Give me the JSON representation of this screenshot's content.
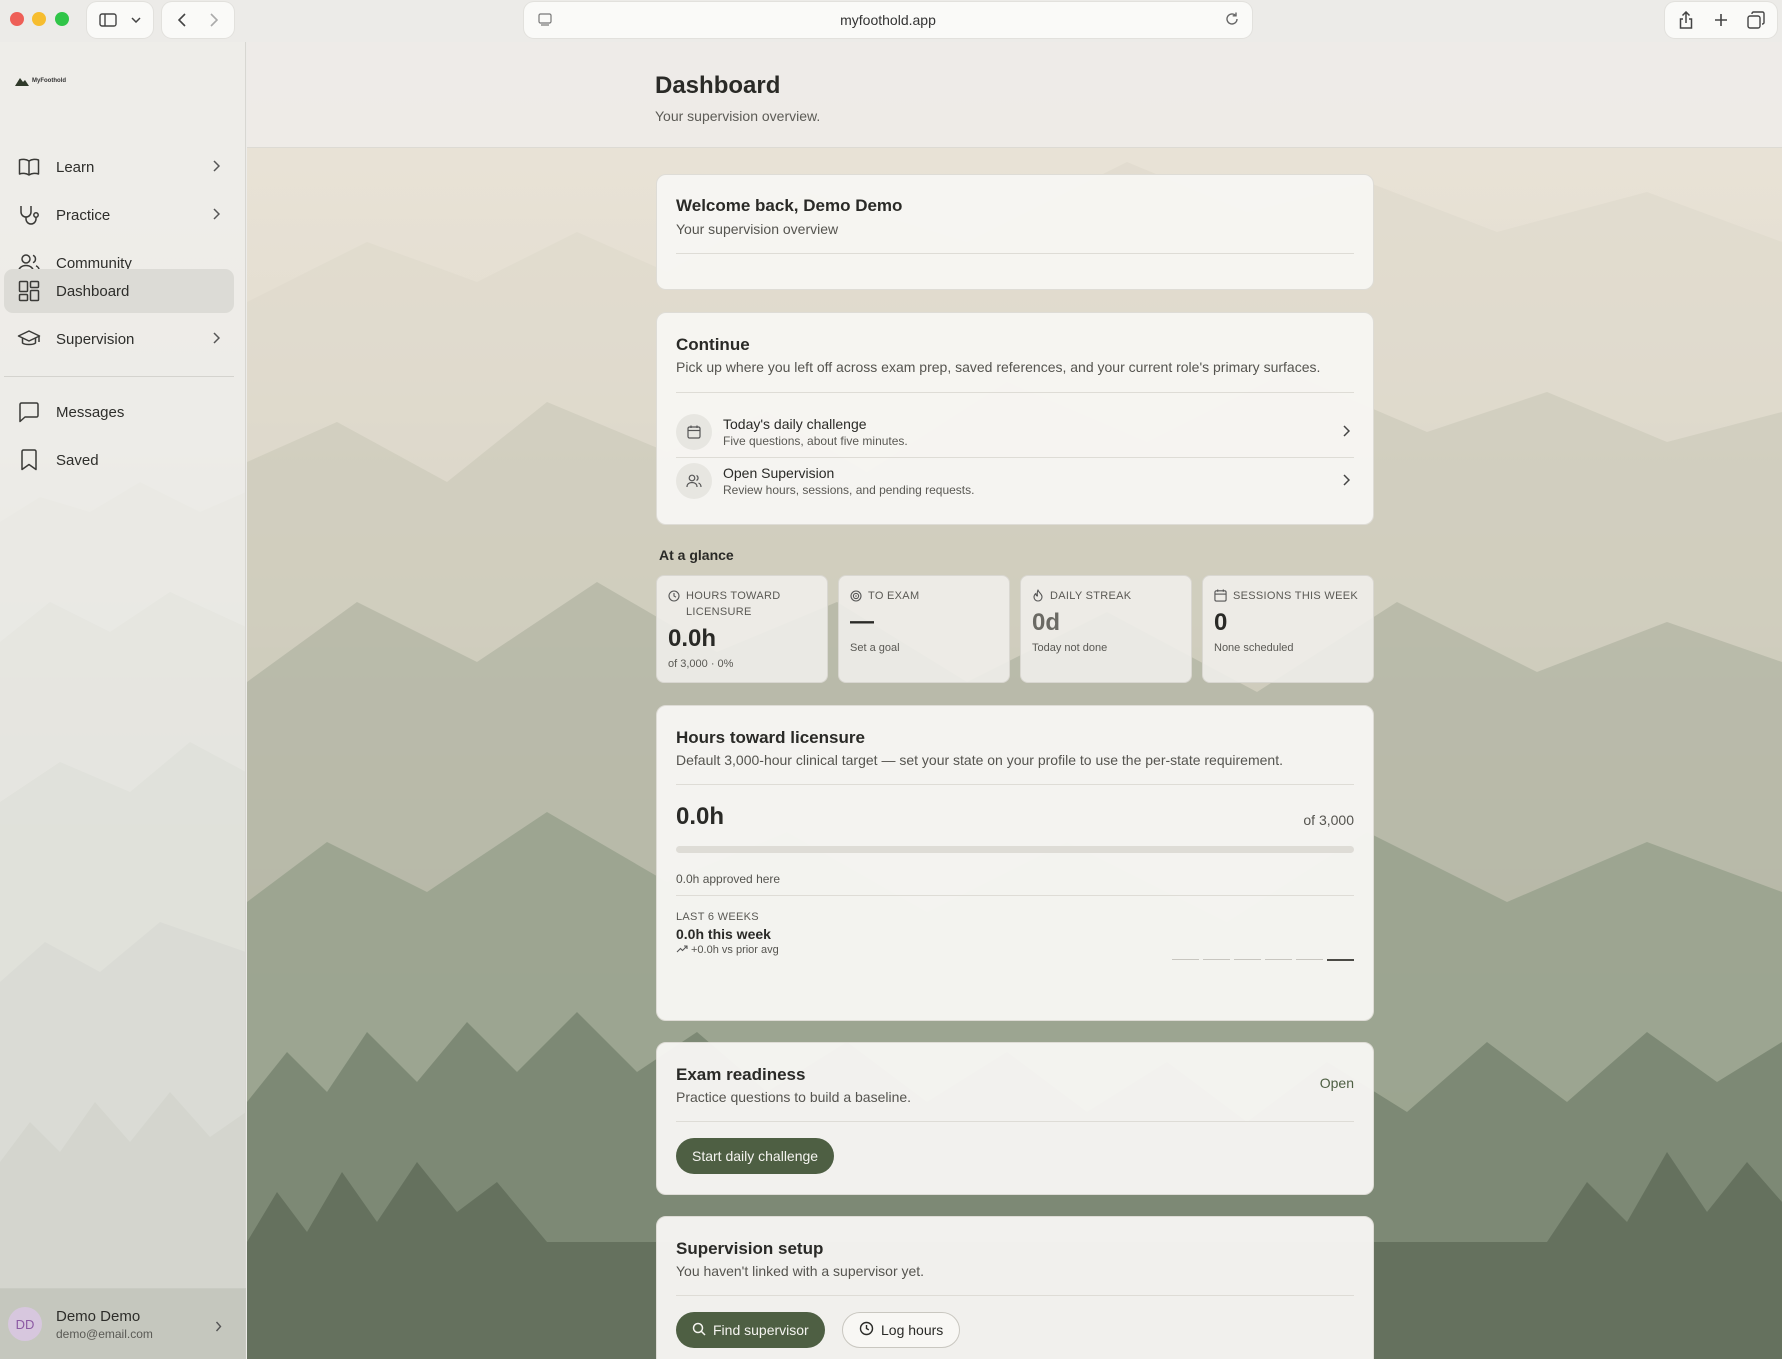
{
  "browser": {
    "url": "myfoothold.app"
  },
  "sidebar": {
    "logo_text": "MyFoothold",
    "items": [
      {
        "label": "Learn",
        "icon": "book-open-icon",
        "has_chevron": true
      },
      {
        "label": "Practice",
        "icon": "stethoscope-icon",
        "has_chevron": true
      },
      {
        "label": "Community",
        "icon": "users-icon",
        "has_chevron": false
      },
      {
        "label": "Dashboard",
        "icon": "layout-grid-icon",
        "has_chevron": false,
        "active": true
      },
      {
        "label": "Supervision",
        "icon": "graduation-cap-icon",
        "has_chevron": true
      }
    ],
    "secondary_items": [
      {
        "label": "Messages",
        "icon": "message-square-icon"
      },
      {
        "label": "Saved",
        "icon": "bookmark-icon"
      }
    ],
    "user": {
      "initials": "DD",
      "name": "Demo Demo",
      "email": "demo@email.com"
    }
  },
  "header": {
    "title": "Dashboard",
    "subtitle": "Your supervision overview."
  },
  "welcome": {
    "title": "Welcome back, Demo Demo",
    "subtitle": "Your supervision overview"
  },
  "continue": {
    "title": "Continue",
    "subtitle": "Pick up where you left off across exam prep, saved references, and your current role's primary surfaces.",
    "rows": [
      {
        "title": "Today's daily challenge",
        "desc": "Five questions, about five minutes.",
        "icon": "calendar-icon"
      },
      {
        "title": "Open Supervision",
        "desc": "Review hours, sessions, and pending requests.",
        "icon": "users-icon"
      }
    ]
  },
  "glance": {
    "label": "At a glance",
    "stats": [
      {
        "label": "HOURS TOWARD LICENSURE",
        "value": "0.0h",
        "note": "of 3,000 · 0%",
        "icon": "clock-icon"
      },
      {
        "label": "TO EXAM",
        "value": "—",
        "note": "Set a goal",
        "icon": "target-icon"
      },
      {
        "label": "DAILY STREAK",
        "value": "0d",
        "note": "Today not done",
        "icon": "flame-icon"
      },
      {
        "label": "SESSIONS THIS WEEK",
        "value": "0",
        "note": "None scheduled",
        "icon": "calendar-icon"
      }
    ]
  },
  "hours": {
    "title": "Hours toward licensure",
    "subtitle": "Default 3,000-hour clinical target — set your state on your profile to use the per-state requirement.",
    "value": "0.0h",
    "of_label": "of 3,000",
    "progress_percent": 0,
    "approved_note": "0.0h approved here",
    "weeks_label": "LAST 6 WEEKS",
    "weeks_value": "0.0h this week",
    "weeks_trend": "+0.0h vs prior avg",
    "weekly_hours": [
      0,
      0,
      0,
      0,
      0,
      0
    ]
  },
  "exam": {
    "title": "Exam readiness",
    "subtitle": "Practice questions to build a baseline.",
    "open_label": "Open",
    "button_label": "Start daily challenge"
  },
  "supervision_setup": {
    "title": "Supervision setup",
    "subtitle": "You haven't linked with a supervisor yet.",
    "find_label": "Find supervisor",
    "log_label": "Log hours"
  },
  "colors": {
    "accent": "#4e5f43",
    "active_nav": "#dcdbd6",
    "avatar_bg": "#d7c7de",
    "avatar_text": "#8c5aa3"
  }
}
